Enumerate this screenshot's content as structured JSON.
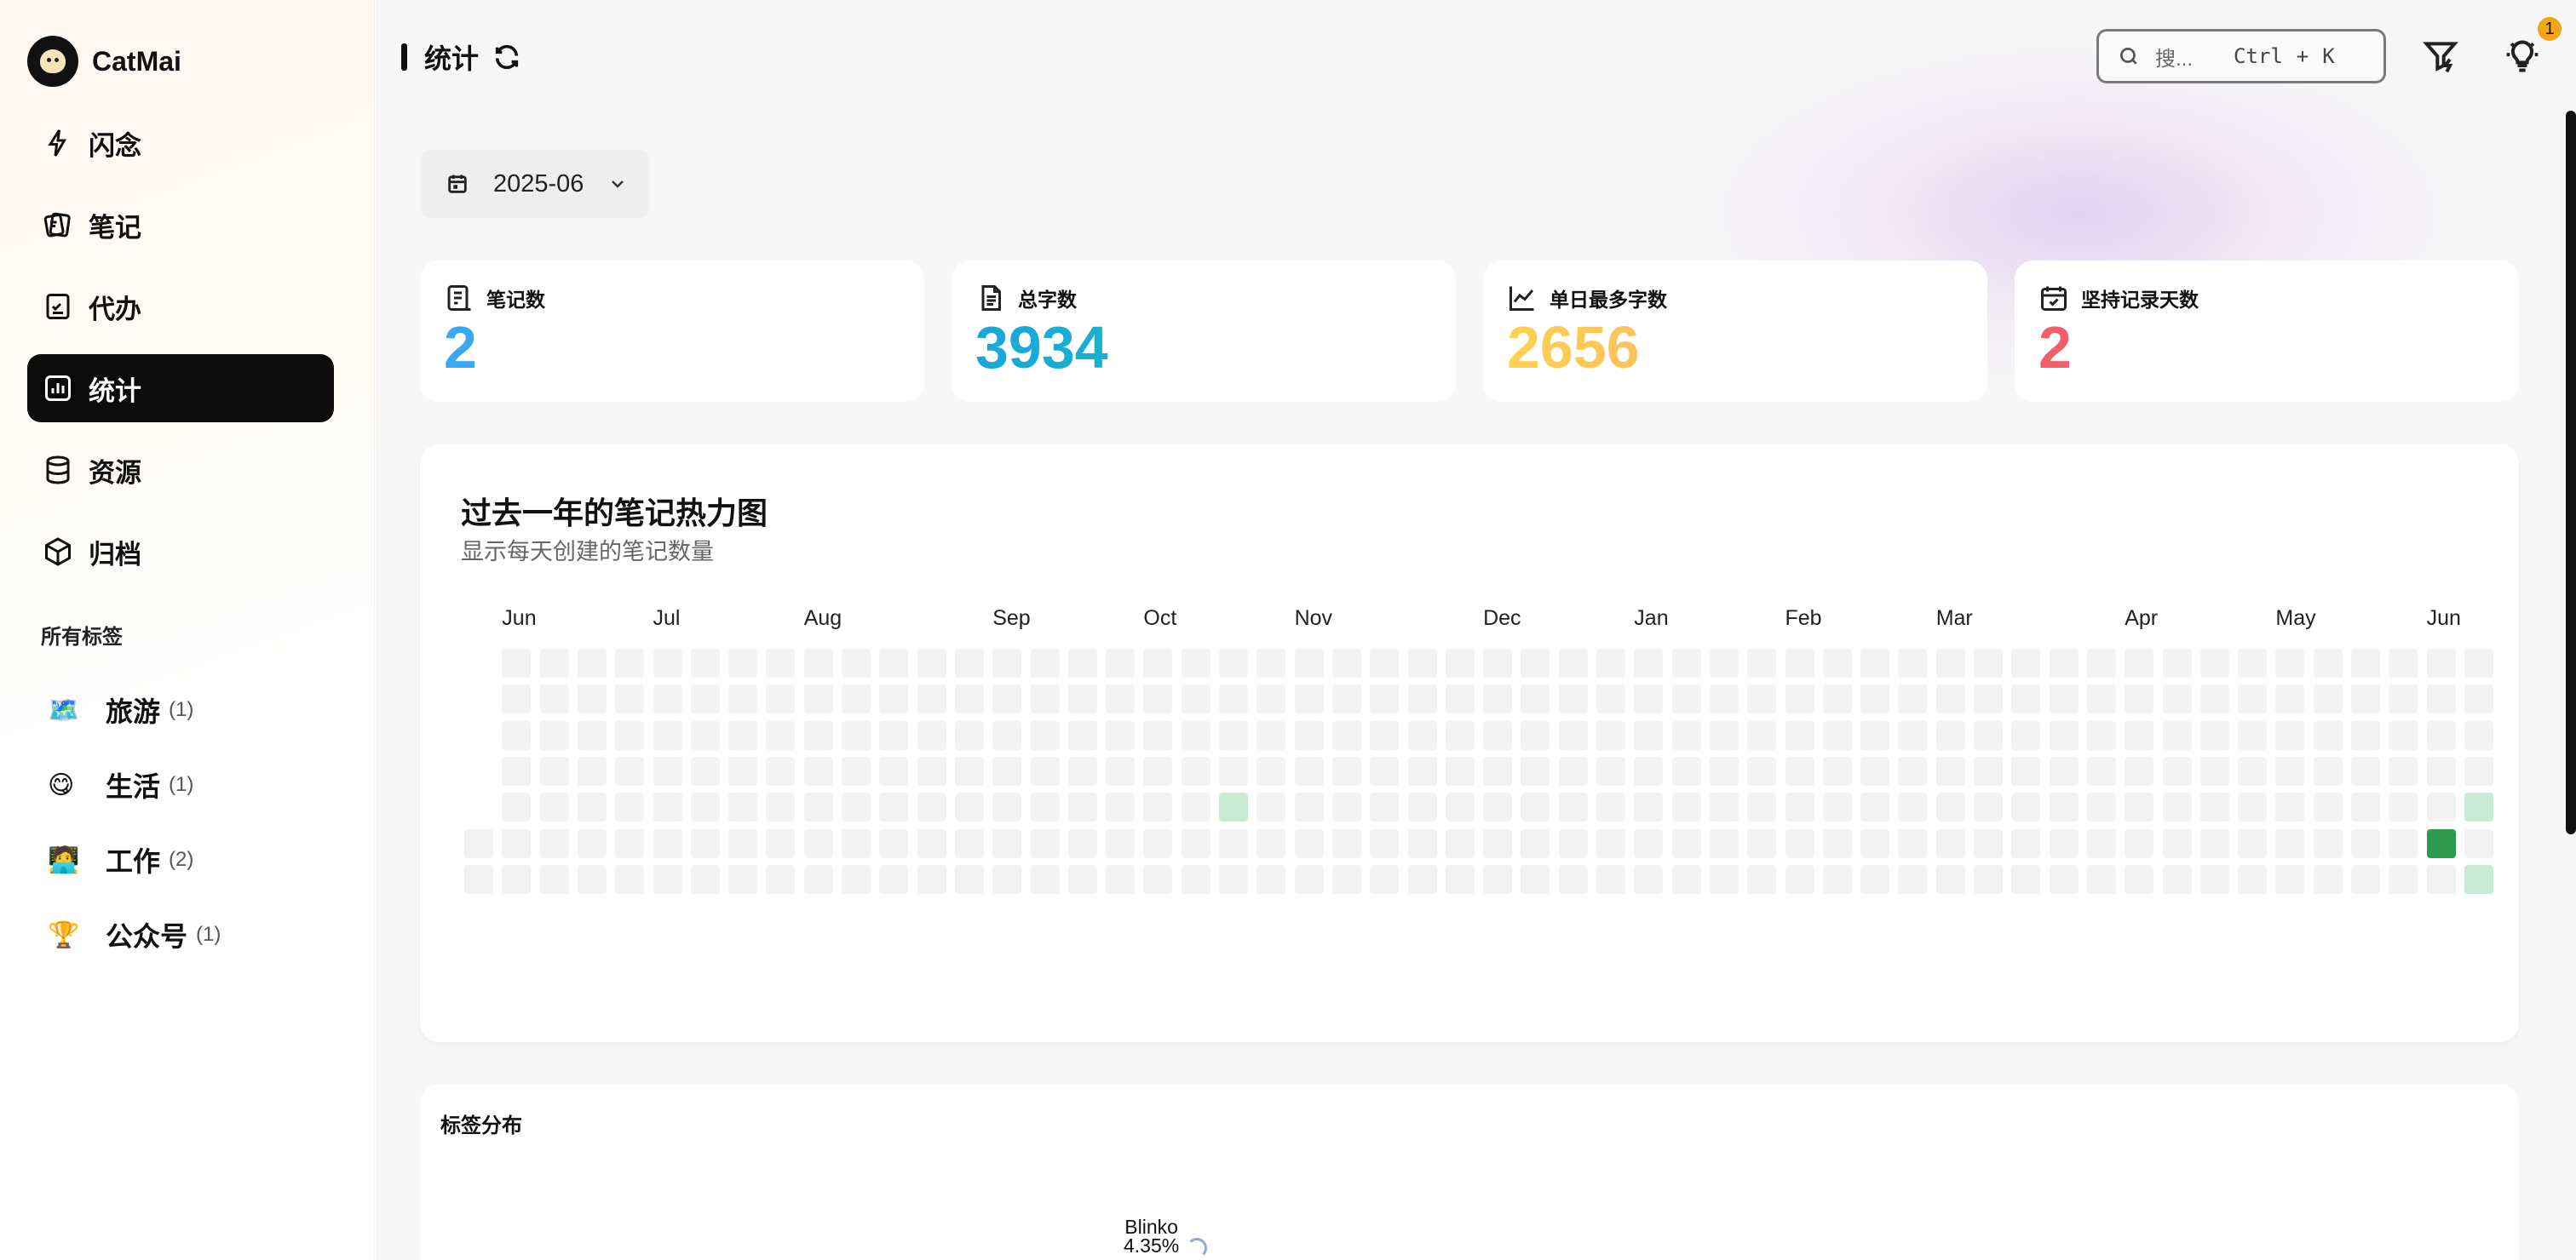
{
  "app": {
    "name": "CatMai"
  },
  "sidebar": {
    "nav": [
      {
        "label": "闪念",
        "icon": "flash-icon"
      },
      {
        "label": "笔记",
        "icon": "notes-icon"
      },
      {
        "label": "代办",
        "icon": "todo-icon"
      },
      {
        "label": "统计",
        "icon": "chart-icon",
        "active": true
      },
      {
        "label": "资源",
        "icon": "database-icon"
      },
      {
        "label": "归档",
        "icon": "archive-box-icon"
      }
    ],
    "tags_title": "所有标签",
    "tags": [
      {
        "emoji": "🗺️",
        "name": "旅游",
        "count": "(1)"
      },
      {
        "emoji": "😋",
        "name": "生活",
        "count": "(1)"
      },
      {
        "emoji": "🧑‍💻",
        "name": "工作",
        "count": "(2)"
      },
      {
        "emoji": "🏆",
        "name": "公众号",
        "count": "(1)"
      }
    ]
  },
  "header": {
    "title": "统计",
    "search_placeholder": "搜...",
    "shortcut": [
      "Ctrl",
      "+",
      "K"
    ],
    "notification_count": "1"
  },
  "month_picker": {
    "value": "2025-06"
  },
  "stats": [
    {
      "label": "笔记数",
      "value": "2",
      "icon": "note-list-icon"
    },
    {
      "label": "总字数",
      "value": "3934",
      "icon": "document-icon"
    },
    {
      "label": "单日最多字数",
      "value": "2656",
      "icon": "line-chart-icon"
    },
    {
      "label": "坚持记录天数",
      "value": "2",
      "icon": "calendar-check-icon"
    }
  ],
  "heatmap": {
    "title": "过去一年的笔记热力图",
    "subtitle": "显示每天创建的笔记数量",
    "months": [
      "Jun",
      "Jul",
      "Aug",
      "Sep",
      "Oct",
      "Nov",
      "Dec",
      "Jan",
      "Feb",
      "Mar",
      "Apr",
      "May",
      "Jun"
    ],
    "weeks": 54,
    "active_cells": [
      {
        "week": 20,
        "day": 4,
        "level": 1
      },
      {
        "week": 52,
        "day": 5,
        "level": 3
      },
      {
        "week": 53,
        "day": 4,
        "level": 1
      },
      {
        "week": 53,
        "day": 6,
        "level": 1
      }
    ],
    "colors": {
      "empty": "#f3f3f3",
      "level1": "#c9ebd3",
      "level3": "#2e9a4f"
    }
  },
  "tag_distribution": {
    "title": "标签分布",
    "label_name": "Blinko",
    "label_pct": "4.35%"
  }
}
